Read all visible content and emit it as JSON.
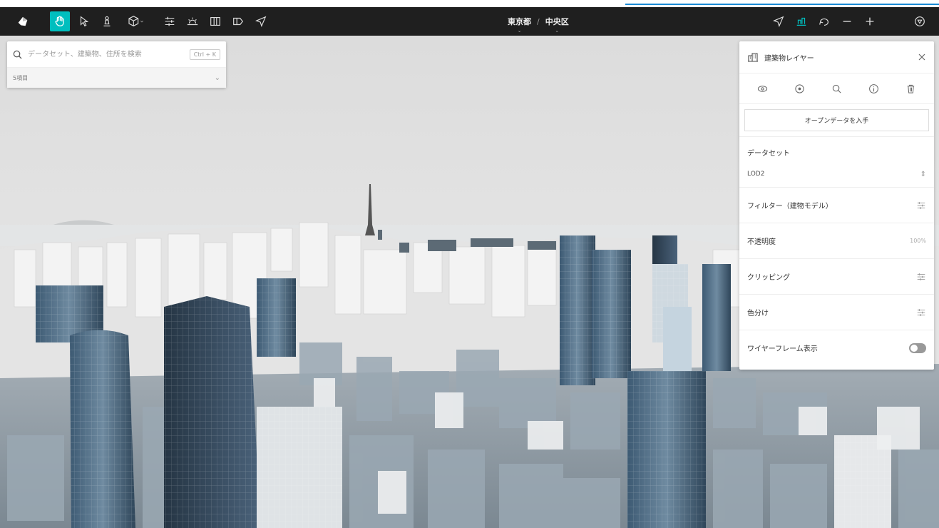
{
  "toolbar": {
    "left_icons": [
      "app-logo-icon",
      "hand-icon",
      "pointer-icon",
      "pedestrian-icon",
      "cube-icon",
      "sliders-icon",
      "sun-icon",
      "book-icon",
      "tag-icon",
      "send-icon"
    ],
    "right_icons": [
      "navigate-icon",
      "layers-icon",
      "undo-icon",
      "minus-icon",
      "plus-icon",
      "compass-icon"
    ],
    "accent": "#00bebe"
  },
  "breadcrumb": {
    "prefecture": "東京都",
    "separator": "/",
    "ward": "中央区"
  },
  "search": {
    "placeholder": "データセット、建築物、住所を検索",
    "shortcut": "Ctrl + K",
    "items_label": "5項目"
  },
  "panel": {
    "title": "建築物レイヤー",
    "open_data_button": "オープンデータを入手",
    "dataset_label": "データセット",
    "dataset_value": "LOD2",
    "filter_label": "フィルター（建物モデル）",
    "opacity_label": "不透明度",
    "opacity_value": "100%",
    "clipping_label": "クリッピング",
    "color_label": "色分け",
    "wireframe_label": "ワイヤーフレーム表示",
    "wireframe_on": false
  }
}
